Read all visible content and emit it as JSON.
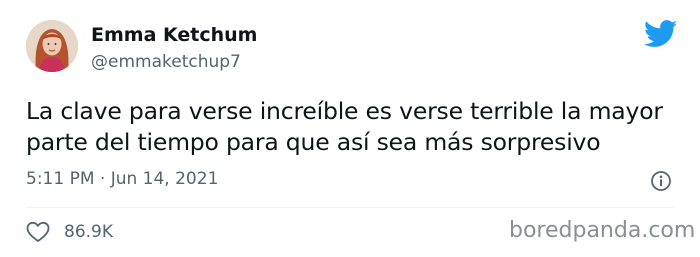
{
  "author": {
    "display_name": "Emma Ketchum",
    "handle": "@emmaketchup7",
    "avatar_icon": "profile-photo"
  },
  "tweet": {
    "text": "La clave para verse increíble es verse terrible la mayor parte del tiempo para que así sea más sorpresivo",
    "meta": "5:11 PM · Jun 14, 2021"
  },
  "engagement": {
    "likes": "86.9K",
    "like_icon": "heart-icon"
  },
  "branding": {
    "platform_icon": "twitter-bird-icon",
    "watermark": "boredpanda.com",
    "accent_color": "#1d9bf0",
    "secondary_text_color": "#536471"
  }
}
